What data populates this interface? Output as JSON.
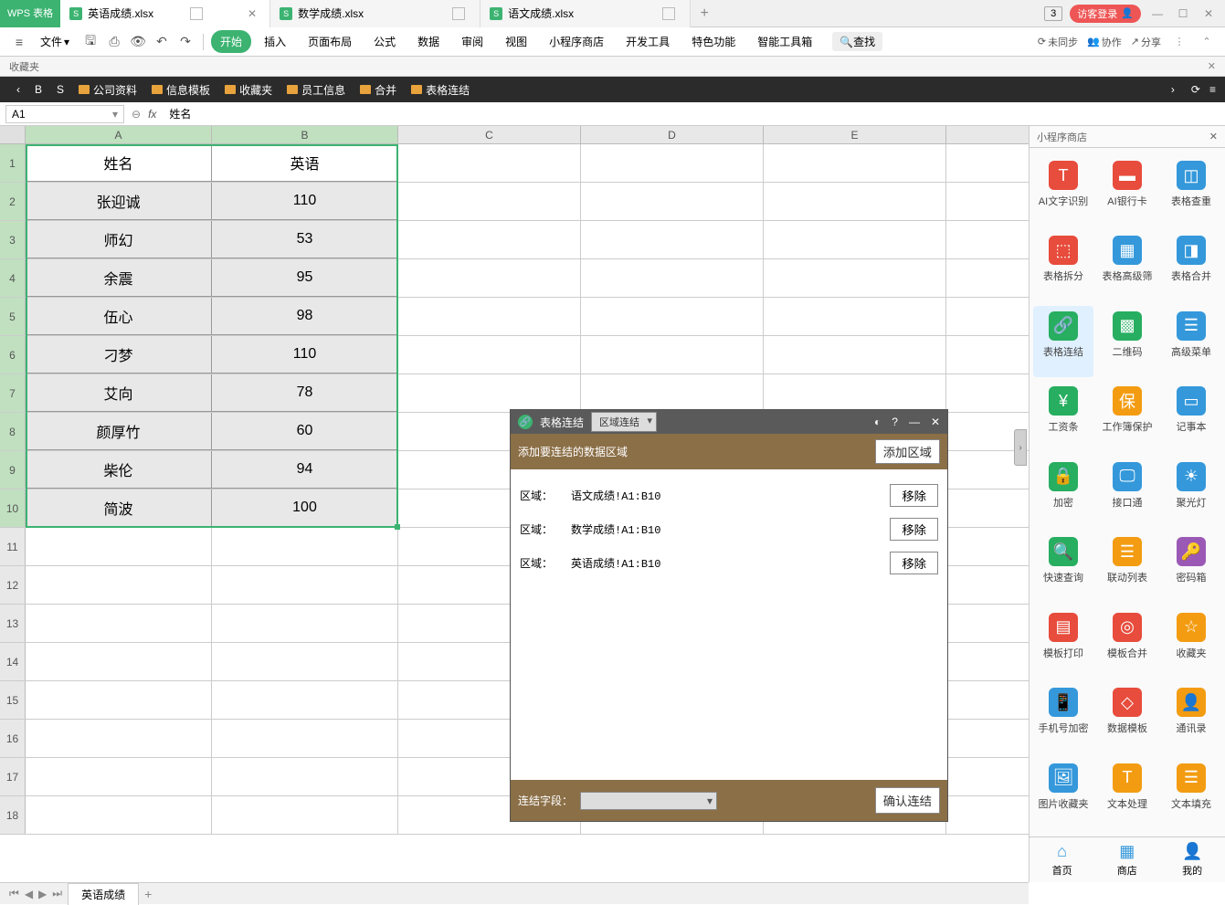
{
  "app": {
    "name": "WPS 表格"
  },
  "tabs": [
    {
      "label": "英语成绩.xlsx",
      "active": true
    },
    {
      "label": "数学成绩.xlsx",
      "active": false
    },
    {
      "label": "语文成绩.xlsx",
      "active": false
    }
  ],
  "titlebar": {
    "badge": "3",
    "login": "访客登录"
  },
  "menubar": {
    "file": "文件",
    "items": [
      "开始",
      "插入",
      "页面布局",
      "公式",
      "数据",
      "审阅",
      "视图",
      "小程序商店",
      "开发工具",
      "特色功能",
      "智能工具箱"
    ],
    "search": "查找",
    "right": {
      "unsync": "未同步",
      "coop": "协作",
      "share": "分享"
    }
  },
  "favbar": {
    "label": "收藏夹"
  },
  "folderbar": {
    "letters": [
      "B",
      "S"
    ],
    "folders": [
      "公司资料",
      "信息模板",
      "收藏夹",
      "员工信息",
      "合并",
      "表格连结"
    ]
  },
  "formula": {
    "cellref": "A1",
    "value": "姓名"
  },
  "columns": [
    "A",
    "B",
    "C",
    "D",
    "E"
  ],
  "sheet": {
    "headers": [
      "姓名",
      "英语"
    ],
    "rows": [
      [
        "张迎诚",
        "110"
      ],
      [
        "师幻",
        "53"
      ],
      [
        "余震",
        "95"
      ],
      [
        "伍心",
        "98"
      ],
      [
        "刁梦",
        "110"
      ],
      [
        "艾向",
        "78"
      ],
      [
        "颜厚竹",
        "60"
      ],
      [
        "柴伦",
        "94"
      ],
      [
        "简波",
        "100"
      ]
    ],
    "tab_name": "英语成绩"
  },
  "dialog": {
    "title": "表格连结",
    "mode": "区域连结",
    "subtitle": "添加要连结的数据区域",
    "add_btn": "添加区域",
    "region_label": "区域：",
    "regions": [
      "语文成绩!A1:B10",
      "数学成绩!A1:B10",
      "英语成绩!A1:B10"
    ],
    "remove": "移除",
    "field_label": "连结字段：",
    "confirm": "确认连结"
  },
  "sidepanel": {
    "title": "小程序商店",
    "items": [
      {
        "label": "AI文字识别",
        "color": "#e74c3c",
        "glyph": "T"
      },
      {
        "label": "AI银行卡",
        "color": "#e74c3c",
        "glyph": "▬"
      },
      {
        "label": "表格查重",
        "color": "#3498db",
        "glyph": "◫"
      },
      {
        "label": "表格拆分",
        "color": "#e74c3c",
        "glyph": "⬚"
      },
      {
        "label": "表格高级筛",
        "color": "#3498db",
        "glyph": "▦"
      },
      {
        "label": "表格合并",
        "color": "#3498db",
        "glyph": "◨"
      },
      {
        "label": "表格连结",
        "color": "#27ae60",
        "glyph": "🔗"
      },
      {
        "label": "二维码",
        "color": "#27ae60",
        "glyph": "▩"
      },
      {
        "label": "高级菜单",
        "color": "#3498db",
        "glyph": "☰"
      },
      {
        "label": "工资条",
        "color": "#27ae60",
        "glyph": "¥"
      },
      {
        "label": "工作簿保护",
        "color": "#f39c12",
        "glyph": "保"
      },
      {
        "label": "记事本",
        "color": "#3498db",
        "glyph": "▭"
      },
      {
        "label": "加密",
        "color": "#27ae60",
        "glyph": "🔒"
      },
      {
        "label": "接口通",
        "color": "#3498db",
        "glyph": "🖵"
      },
      {
        "label": "聚光灯",
        "color": "#3498db",
        "glyph": "☀"
      },
      {
        "label": "快速查询",
        "color": "#27ae60",
        "glyph": "🔍"
      },
      {
        "label": "联动列表",
        "color": "#f39c12",
        "glyph": "☰"
      },
      {
        "label": "密码箱",
        "color": "#9b59b6",
        "glyph": "🔑"
      },
      {
        "label": "模板打印",
        "color": "#e74c3c",
        "glyph": "▤"
      },
      {
        "label": "模板合并",
        "color": "#e74c3c",
        "glyph": "◎"
      },
      {
        "label": "收藏夹",
        "color": "#f39c12",
        "glyph": "☆"
      },
      {
        "label": "手机号加密",
        "color": "#3498db",
        "glyph": "📱"
      },
      {
        "label": "数据模板",
        "color": "#e74c3c",
        "glyph": "◇"
      },
      {
        "label": "通讯录",
        "color": "#f39c12",
        "glyph": "👤"
      },
      {
        "label": "图片收藏夹",
        "color": "#3498db",
        "glyph": "🖼"
      },
      {
        "label": "文本处理",
        "color": "#f39c12",
        "glyph": "T"
      },
      {
        "label": "文本填充",
        "color": "#f39c12",
        "glyph": "☰"
      }
    ],
    "nav": [
      {
        "label": "首页",
        "glyph": "⌂",
        "color": "#3498db"
      },
      {
        "label": "商店",
        "glyph": "▦",
        "color": "#3498db"
      },
      {
        "label": "我的",
        "glyph": "👤",
        "color": "#3498db"
      }
    ]
  }
}
